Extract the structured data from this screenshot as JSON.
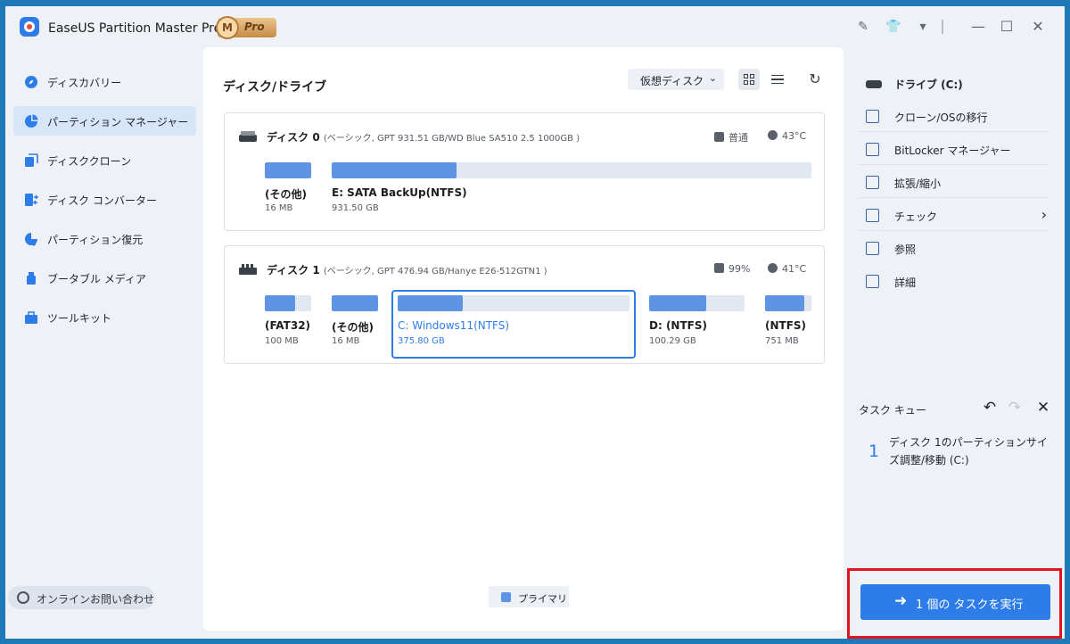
{
  "app": {
    "title": "EaseUS Partition Master Pro版",
    "badge_letter": "M",
    "badge_text": "Pro"
  },
  "sidebar": {
    "items": [
      {
        "label": "ディスカバリー",
        "icon": "compass-icon"
      },
      {
        "label": "パーティション マネージャー",
        "icon": "pie-chart-icon"
      },
      {
        "label": "ディスククローン",
        "icon": "disk-clone-icon"
      },
      {
        "label": "ディスク コンバーター",
        "icon": "disk-converter-icon"
      },
      {
        "label": "パーティション復元",
        "icon": "partition-recovery-icon"
      },
      {
        "label": "ブータブル メディア",
        "icon": "usb-icon"
      },
      {
        "label": "ツールキット",
        "icon": "toolkit-icon"
      }
    ],
    "active_index": 1,
    "contact_label": "オンラインお問い合わせ"
  },
  "main": {
    "title": "ディスク/ドライブ",
    "virtual_disk_label": "仮想ディスク",
    "disks": [
      {
        "name": "ディスク 0",
        "description": "(ベーシック, GPT 931.51 GB/WD Blue SA510 2.5 1000GB )",
        "health": "普通",
        "temperature": "43°C",
        "partitions": [
          {
            "name": "(その他)",
            "size": "16 MB",
            "used_fraction": 1.0
          },
          {
            "name": "E: SATA BackUp(NTFS)",
            "size": "931.50 GB",
            "used_fraction": 0.26
          }
        ]
      },
      {
        "name": "ディスク 1",
        "description": "(ベーシック, GPT 476.94 GB/Hanye E26-512GTN1 )",
        "health": "99%",
        "temperature": "41°C",
        "partitions": [
          {
            "name": "(FAT32)",
            "size": "100 MB",
            "used_fraction": 0.65
          },
          {
            "name": "(その他)",
            "size": "16 MB",
            "used_fraction": 1.0
          },
          {
            "name": "C: Windows11(NTFS)",
            "size": "375.80 GB",
            "used_fraction": 0.28,
            "selected": true
          },
          {
            "name": "D: (NTFS)",
            "size": "100.29 GB",
            "used_fraction": 0.6
          },
          {
            "name": "(NTFS)",
            "size": "751 MB",
            "used_fraction": 0.85
          }
        ]
      }
    ],
    "legend_label": "プライマリ"
  },
  "right_panel": {
    "operations": [
      {
        "label": "ドライブ (C:)",
        "icon": "drive-icon"
      },
      {
        "label": "クローン/OSの移行",
        "icon": "clone-icon"
      },
      {
        "label": "BitLocker マネージャー",
        "icon": "bitlocker-icon"
      },
      {
        "label": "拡張/縮小",
        "icon": "resize-icon"
      },
      {
        "label": "チェック",
        "icon": "check-icon"
      },
      {
        "label": "参照",
        "icon": "browse-icon"
      },
      {
        "label": "詳細",
        "icon": "details-icon"
      }
    ],
    "queue_title": "タスク キュー",
    "tasks": [
      {
        "number": "1",
        "text": "ディスク 1のパーティションサイズ調整/移動 (C:)"
      }
    ],
    "execute_label": "1 個の タスクを実行"
  },
  "colors": {
    "accent": "#2e7ce8",
    "partition_fill": "#5f93e3",
    "highlight_frame": "#e1151e"
  }
}
